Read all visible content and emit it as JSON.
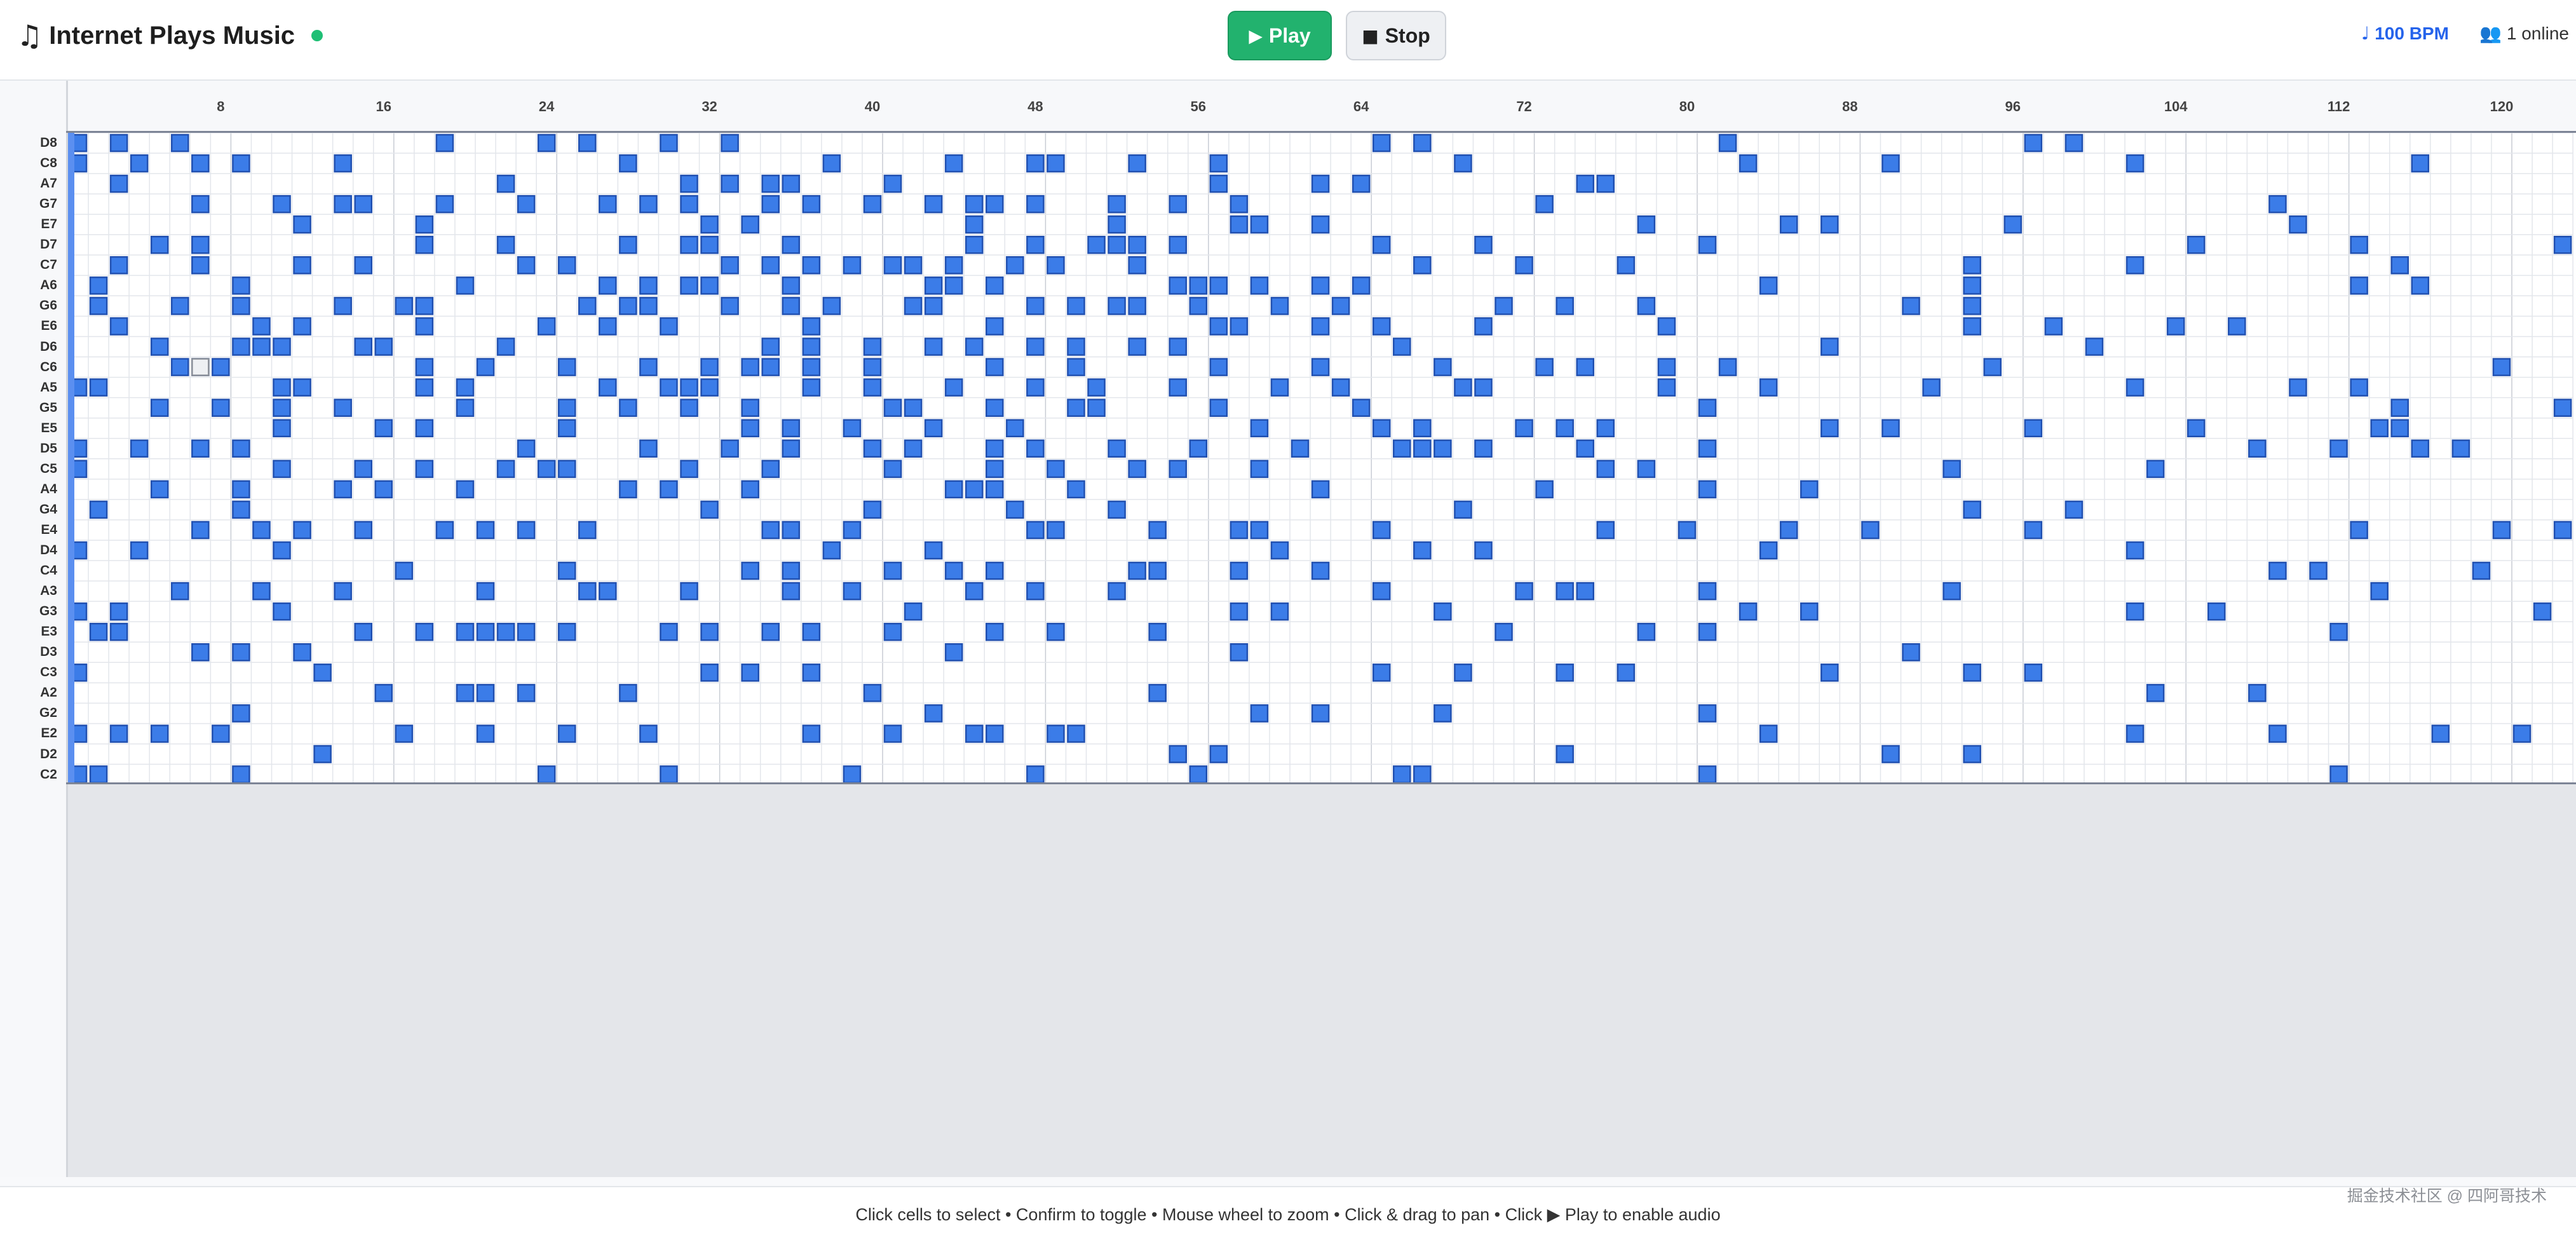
{
  "app": {
    "title": "Internet Plays Music",
    "note_icon": "♫",
    "live_color": "#1fbf75"
  },
  "controls": {
    "play_label": "Play",
    "play_icon": "▶",
    "stop_label": "Stop",
    "stop_icon": "■"
  },
  "status": {
    "bpm": "100 BPM",
    "bpm_icon": "♩",
    "online": "1 online",
    "online_icon": "👥"
  },
  "ruler": {
    "ticks": [
      "8",
      "16",
      "24",
      "32",
      "40",
      "48",
      "56",
      "64",
      "72",
      "80",
      "88",
      "96",
      "104",
      "112",
      "120"
    ]
  },
  "notes": [
    "D8",
    "C8",
    "A7",
    "G7",
    "E7",
    "D7",
    "C7",
    "A6",
    "G6",
    "E6",
    "D6",
    "C6",
    "A5",
    "G5",
    "E5",
    "D5",
    "C5",
    "A4",
    "G4",
    "E4",
    "D4",
    "C4",
    "A3",
    "G3",
    "E3",
    "D3",
    "C3",
    "A2",
    "G2",
    "E2",
    "D2",
    "C2"
  ],
  "grid": {
    "steps": 123,
    "active_color": "#3b7ce8",
    "active_border": "#2150b0",
    "selected": {
      "row": 11,
      "col": 6
    },
    "rows": [
      [
        0,
        2,
        5,
        18,
        23,
        25,
        29,
        32,
        64,
        66,
        81,
        96,
        98
      ],
      [
        0,
        3,
        6,
        8,
        13,
        27,
        37,
        43,
        47,
        48,
        52,
        56,
        68,
        82,
        89,
        101,
        115
      ],
      [
        2,
        21,
        30,
        32,
        34,
        35,
        40,
        56,
        61,
        63,
        74,
        75
      ],
      [
        6,
        10,
        13,
        14,
        18,
        22,
        26,
        28,
        30,
        34,
        36,
        39,
        42,
        44,
        45,
        47,
        51,
        54,
        57,
        72,
        108
      ],
      [
        11,
        17,
        31,
        33,
        44,
        51,
        57,
        58,
        61,
        77,
        84,
        86,
        95,
        109
      ],
      [
        4,
        6,
        17,
        21,
        27,
        30,
        31,
        35,
        44,
        47,
        50,
        51,
        52,
        54,
        64,
        69,
        80,
        104,
        112,
        122
      ],
      [
        2,
        6,
        11,
        14,
        22,
        24,
        32,
        34,
        36,
        38,
        40,
        41,
        43,
        46,
        48,
        52,
        66,
        71,
        76,
        93,
        101,
        114
      ],
      [
        1,
        8,
        19,
        26,
        28,
        30,
        31,
        35,
        42,
        43,
        45,
        54,
        55,
        56,
        58,
        61,
        63,
        83,
        93,
        112,
        115
      ],
      [
        1,
        5,
        8,
        13,
        16,
        17,
        25,
        27,
        28,
        32,
        35,
        37,
        41,
        42,
        47,
        49,
        51,
        52,
        55,
        59,
        62,
        70,
        73,
        77,
        90,
        93
      ],
      [
        2,
        9,
        11,
        17,
        23,
        26,
        29,
        36,
        45,
        56,
        57,
        61,
        64,
        69,
        78,
        93,
        97,
        103,
        106
      ],
      [
        4,
        8,
        9,
        10,
        14,
        15,
        21,
        34,
        36,
        39,
        42,
        44,
        47,
        49,
        52,
        54,
        65,
        86,
        99
      ],
      [
        5,
        6,
        7,
        17,
        20,
        24,
        28,
        31,
        33,
        34,
        36,
        39,
        45,
        49,
        56,
        61,
        67,
        72,
        74,
        78,
        81,
        94,
        119
      ],
      [
        0,
        1,
        10,
        11,
        17,
        19,
        26,
        29,
        30,
        31,
        36,
        39,
        43,
        47,
        50,
        54,
        59,
        62,
        68,
        69,
        78,
        83,
        91,
        101,
        109,
        112
      ],
      [
        4,
        7,
        10,
        13,
        19,
        24,
        27,
        30,
        33,
        40,
        41,
        45,
        49,
        50,
        56,
        63,
        80,
        114,
        122
      ],
      [
        10,
        15,
        17,
        24,
        33,
        35,
        38,
        42,
        46,
        58,
        64,
        66,
        71,
        73,
        75,
        86,
        89,
        96,
        104,
        113,
        114
      ],
      [
        0,
        3,
        6,
        8,
        22,
        28,
        32,
        35,
        39,
        41,
        45,
        47,
        51,
        55,
        60,
        65,
        66,
        67,
        69,
        74,
        80,
        107,
        111,
        115,
        117
      ],
      [
        0,
        10,
        14,
        17,
        21,
        23,
        24,
        30,
        34,
        40,
        45,
        48,
        52,
        54,
        58,
        75,
        77,
        92,
        102
      ],
      [
        4,
        8,
        13,
        15,
        19,
        27,
        29,
        33,
        43,
        44,
        45,
        49,
        61,
        72,
        80,
        85
      ],
      [
        1,
        8,
        31,
        39,
        46,
        51,
        68,
        93,
        98
      ],
      [
        6,
        9,
        11,
        14,
        18,
        20,
        22,
        25,
        34,
        35,
        38,
        47,
        48,
        53,
        57,
        58,
        64,
        75,
        79,
        84,
        88,
        96,
        112,
        119,
        122
      ],
      [
        0,
        3,
        10,
        37,
        42,
        59,
        66,
        69,
        83,
        101
      ],
      [
        16,
        24,
        33,
        35,
        40,
        43,
        45,
        52,
        53,
        57,
        61,
        108,
        110,
        118
      ],
      [
        5,
        9,
        13,
        20,
        25,
        26,
        30,
        35,
        38,
        44,
        47,
        51,
        64,
        71,
        73,
        74,
        80,
        92,
        113
      ],
      [
        0,
        2,
        10,
        41,
        57,
        59,
        67,
        82,
        85,
        101,
        105,
        121
      ],
      [
        1,
        2,
        14,
        17,
        19,
        20,
        21,
        22,
        24,
        29,
        31,
        34,
        36,
        40,
        45,
        48,
        53,
        70,
        77,
        80,
        111
      ],
      [
        6,
        8,
        11,
        43,
        57,
        90
      ],
      [
        0,
        12,
        31,
        33,
        36,
        64,
        68,
        73,
        76,
        86,
        93,
        96
      ],
      [
        15,
        19,
        20,
        22,
        27,
        39,
        53,
        102,
        107
      ],
      [
        8,
        42,
        58,
        61,
        67,
        80
      ],
      [
        0,
        2,
        4,
        7,
        16,
        20,
        24,
        28,
        36,
        40,
        44,
        45,
        48,
        49,
        83,
        101,
        108,
        116,
        120
      ],
      [
        12,
        54,
        56,
        73,
        89,
        93
      ],
      [
        0,
        1,
        8,
        23,
        29,
        38,
        47,
        55,
        65,
        66,
        80,
        111
      ]
    ]
  }
}
